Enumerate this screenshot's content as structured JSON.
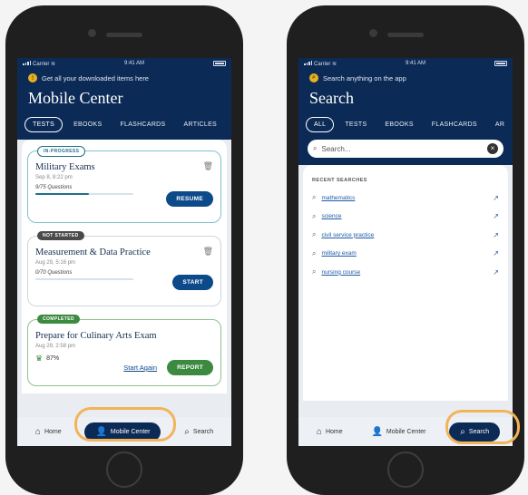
{
  "status": {
    "carrier": "Carrier",
    "time": "9:41 AM"
  },
  "left": {
    "notice": "Get all your downloaded items here",
    "title": "Mobile Center",
    "tabs": [
      "TESTS",
      "EBOOKS",
      "FLASHCARDS",
      "ARTICLES"
    ],
    "cards": [
      {
        "badge": "IN-PROGRESS",
        "title": "Military Exams",
        "date": "Sep 8, 8:22 pm",
        "questions": "9/75 Questions",
        "progress": 0.55,
        "button": "RESUME"
      },
      {
        "badge": "NOT STARTED",
        "title": "Measurement & Data Practice",
        "date": "Aug 29, 5:16 pm",
        "questions": "0/70 Questions",
        "progress": 0.0,
        "button": "START"
      },
      {
        "badge": "COMPLETED",
        "title": "Prepare for Culinary Arts Exam",
        "date": "Aug 29, 2:58 pm",
        "score": "87%",
        "again": "Start Again",
        "button": "REPORT"
      }
    ],
    "tabbar": [
      "Home",
      "Mobile Center",
      "Search"
    ]
  },
  "right": {
    "notice": "Search anything on the app",
    "title": "Search",
    "tabs": [
      "ALL",
      "TESTS",
      "EBOOKS",
      "FLASHCARDS",
      "AR"
    ],
    "search_placeholder": "Search...",
    "recent_label": "RECENT SEARCHES",
    "recent": [
      "mathematics",
      "science",
      "civil service practice",
      "military exam",
      "nursing course"
    ],
    "tabbar": [
      "Home",
      "Mobile Center",
      "Search"
    ]
  },
  "colors": {
    "navy": "#0c2a56",
    "highlight": "#f2b45a",
    "green": "#3c8a40"
  }
}
